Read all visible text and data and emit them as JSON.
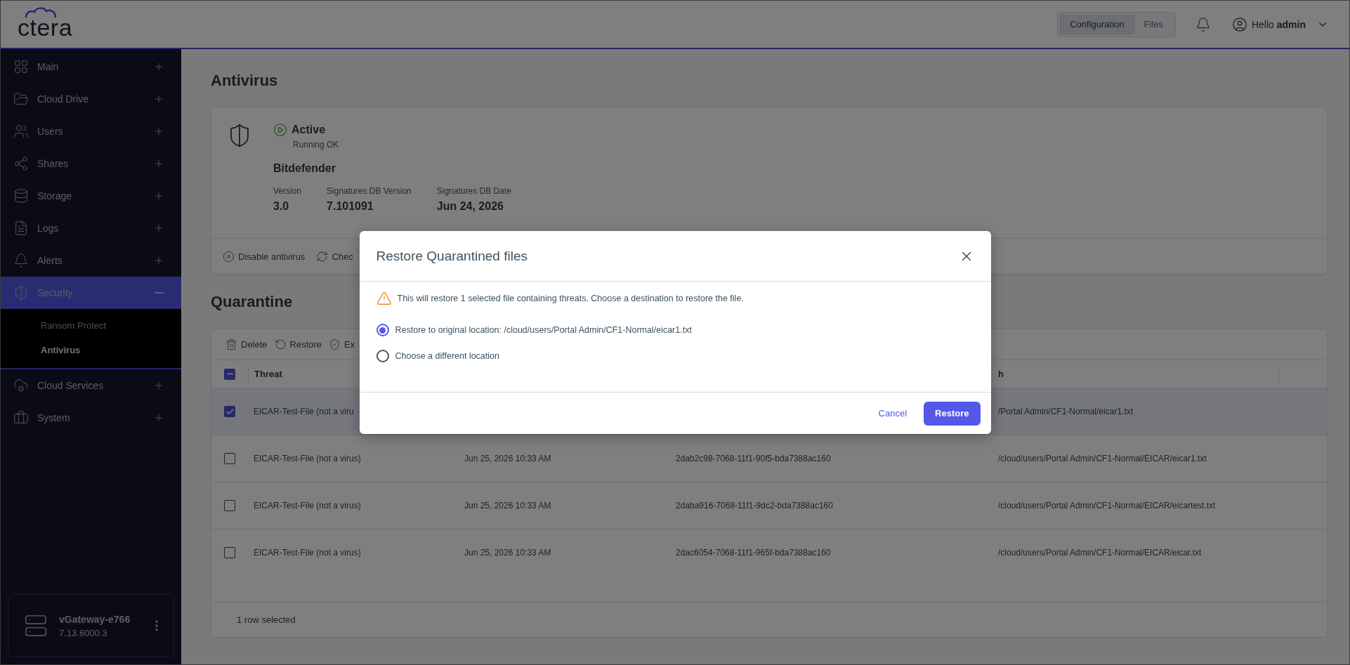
{
  "logo": "ctera",
  "header": {
    "tabs": [
      {
        "label": "Configuration",
        "selected": true
      },
      {
        "label": "Files",
        "selected": false
      }
    ],
    "greeting": "Hello",
    "user": "admin"
  },
  "sidebar": {
    "items": [
      {
        "kind": "grid",
        "label": "Main",
        "expanded": false,
        "selected": false
      },
      {
        "kind": "folder",
        "label": "Cloud Drive",
        "expanded": false,
        "selected": false
      },
      {
        "kind": "users",
        "label": "Users",
        "expanded": false,
        "selected": false
      },
      {
        "kind": "share",
        "label": "Shares",
        "expanded": false,
        "selected": false
      },
      {
        "kind": "storage",
        "label": "Storage",
        "expanded": false,
        "selected": false
      },
      {
        "kind": "logs",
        "label": "Logs",
        "expanded": false,
        "selected": false
      },
      {
        "kind": "bell",
        "label": "Alerts",
        "expanded": false,
        "selected": false
      },
      {
        "kind": "shield",
        "label": "Security",
        "expanded": true,
        "selected": true,
        "children": [
          {
            "label": "Ransom Protect",
            "selected": false
          },
          {
            "label": "Antivirus",
            "selected": true
          }
        ]
      },
      {
        "kind": "cloudcog",
        "label": "Cloud Services",
        "expanded": false,
        "selected": false
      },
      {
        "kind": "briefcase",
        "label": "System",
        "expanded": false,
        "selected": false
      }
    ],
    "device": {
      "name": "vGateway-e766",
      "version": "7.13.6000.3"
    }
  },
  "page_title": "Antivirus",
  "antivirus": {
    "status": "Active",
    "status_detail": "Running OK",
    "vendor": "Bitdefender",
    "fields": [
      {
        "label": "Version",
        "value": "3.0"
      },
      {
        "label": "Signatures DB Version",
        "value": "7.101091"
      },
      {
        "label": "Signatures DB Date",
        "value": "Jun 24, 2026"
      }
    ],
    "actions": [
      {
        "kind": "disable",
        "label": "Disable antivirus"
      },
      {
        "kind": "check",
        "label": "Chec"
      }
    ]
  },
  "quarantine": {
    "title": "Quarantine",
    "toolbar": [
      {
        "kind": "delete",
        "label": "Delete"
      },
      {
        "kind": "restore",
        "label": "Restore"
      },
      {
        "kind": "exclude",
        "label": "Ex"
      }
    ],
    "select_all_partial": true,
    "columns": {
      "threat": "Threat",
      "column_4": "h"
    },
    "rows": [
      {
        "selected": true,
        "threat": "EICAR-Test-File (not a viru",
        "column_4": "/Portal Admin/CF1-Normal/eicar1.txt"
      },
      {
        "selected": false,
        "threat": "EICAR-Test-File (not a virus)",
        "column_2": "Jun 25, 2026 10:33 AM",
        "column_3": "2dab2c98-7068-11f1-90f5-bda7388ac160",
        "column_4": "/cloud/users/Portal Admin/CF1-Normal/EICAR/eicar1.txt"
      },
      {
        "selected": false,
        "threat": "EICAR-Test-File (not a virus)",
        "column_2": "Jun 25, 2026 10:33 AM",
        "column_3": "2daba916-7068-11f1-9dc2-bda7388ac160",
        "column_4": "/cloud/users/Portal Admin/CF1-Normal/EICAR/eicartest.txt"
      },
      {
        "selected": false,
        "threat": "EICAR-Test-File (not a virus)",
        "column_2": "Jun 25, 2026 10:33 AM",
        "column_3": "2dac6054-7068-11f1-965f-bda7388ac160",
        "column_4": "/cloud/users/Portal Admin/CF1-Normal/EICAR/eicar.txt"
      }
    ],
    "footer": "1 row selected"
  },
  "dialog": {
    "title": "Restore Quarantined files",
    "warning": "This will restore 1 selected file containing threats. Choose a destination to restore the file.",
    "options": [
      {
        "label": "Restore to original location: /cloud/users/Portal Admin/CF1-Normal/eicar1.txt",
        "selected": true
      },
      {
        "label": "Choose a different location",
        "selected": false
      }
    ],
    "cancel": "Cancel",
    "confirm": "Restore"
  }
}
